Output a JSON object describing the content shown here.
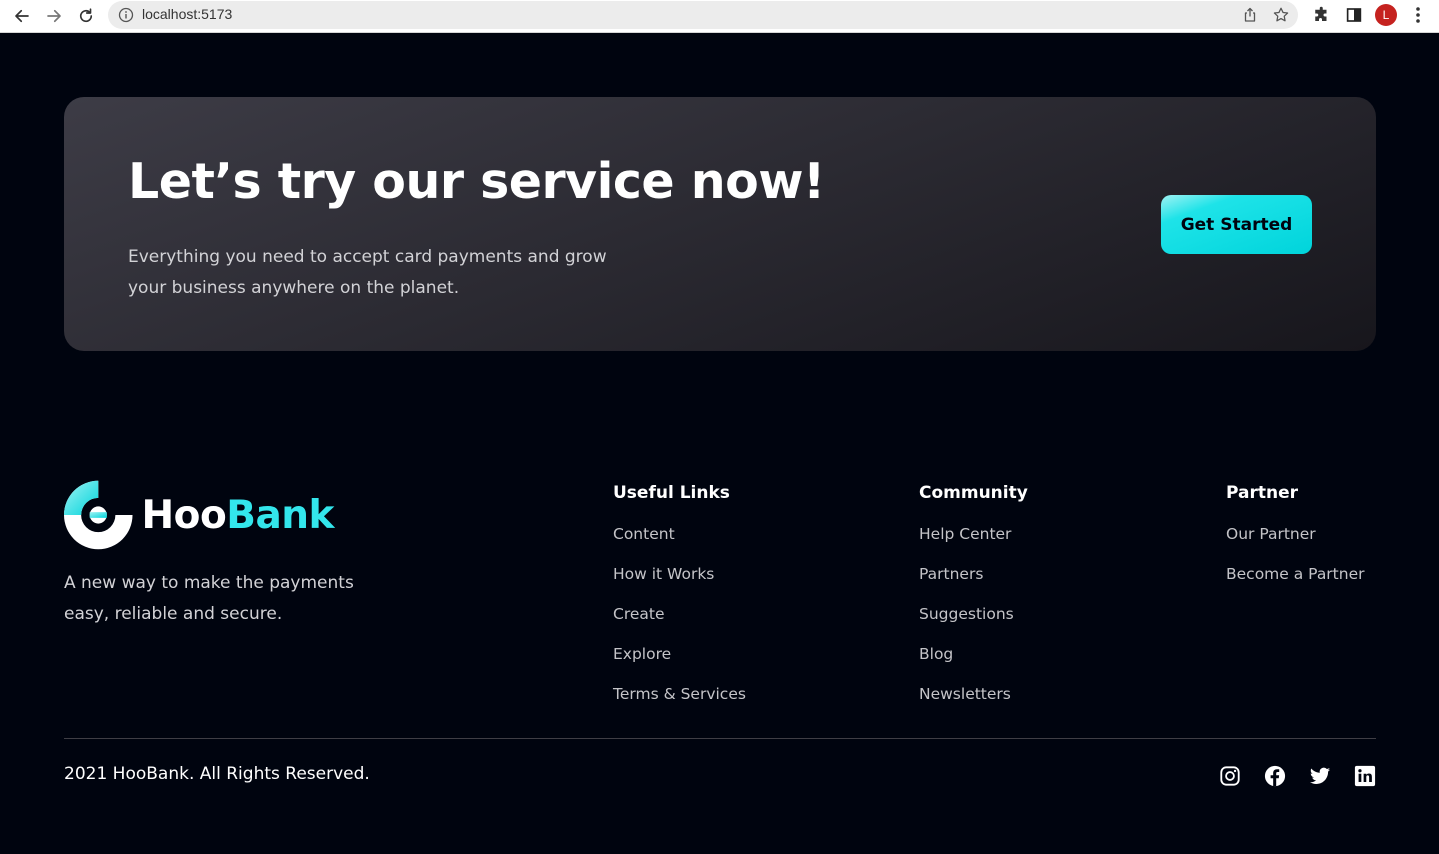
{
  "browser": {
    "url": "localhost:5173",
    "profile_initial": "L",
    "icons": [
      "back-arrow-icon",
      "forward-arrow-icon",
      "reload-icon",
      "info-icon",
      "share-icon",
      "star-icon",
      "puzzle-icon",
      "sidebar-icon",
      "kebab-menu-icon"
    ]
  },
  "cta": {
    "title": "Let’s try our service now!",
    "text": "Everything you need to accept card payments and grow your business anywhere on the planet.",
    "button_label": "Get Started"
  },
  "footer": {
    "logo": {
      "part1": "Hoo",
      "part2": "Bank",
      "accent_color": "#33e6ec"
    },
    "tagline": "A new way to make the payments easy, reliable and secure.",
    "columns": [
      {
        "title": "Useful Links",
        "links": [
          "Content",
          "How it Works",
          "Create",
          "Explore",
          "Terms & Services"
        ]
      },
      {
        "title": "Community",
        "links": [
          "Help Center",
          "Partners",
          "Suggestions",
          "Blog",
          "Newsletters"
        ]
      },
      {
        "title": "Partner",
        "links": [
          "Our Partner",
          "Become a Partner"
        ]
      }
    ],
    "copyright": "2021 HooBank. All Rights Reserved.",
    "social_icons": [
      "instagram-icon",
      "facebook-icon",
      "twitter-icon",
      "linkedin-icon"
    ]
  },
  "colors": {
    "background": "#00040f",
    "button_gradient_start": "#9ff2f3",
    "button_gradient_end": "#00d4db"
  }
}
